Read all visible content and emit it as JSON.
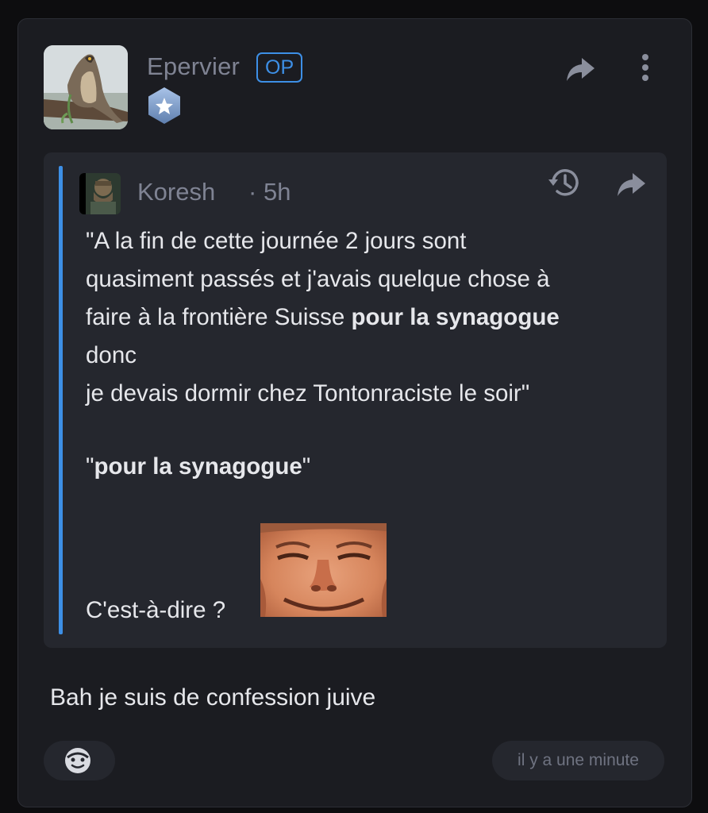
{
  "post": {
    "author": "Epervier",
    "op_badge": "OP",
    "reply_text": "Bah je suis de confession juive",
    "timestamp": "il y a une minute"
  },
  "quote": {
    "author": "Koresh",
    "separator": "·",
    "time": "5h",
    "line1": "\"A la fin de cette journée 2 jours sont",
    "line2": "quasiment passés et j'avais quelque chose à",
    "line3_pre": "faire à la frontière Suisse ",
    "line3_bold": "pour la synagogue",
    "line4": "donc",
    "line5": "je devais dormir chez Tontonraciste le soir\"",
    "emph_open": "\"",
    "emph_bold": "pour la synagogue",
    "emph_close": "\"",
    "last_line": "C'est-à-dire ?"
  },
  "icons": {
    "share_top": "share-arrow-icon",
    "more": "vertical-dots-icon",
    "rank": "hexagon-star-icon",
    "history": "history-clock-icon",
    "share_quote": "share-arrow-icon",
    "reaction": "emoji-face-icon"
  },
  "colors": {
    "accent": "#3d8fe6",
    "card_bg": "#1b1c21",
    "quote_bg": "#25272e",
    "muted_text": "#7f8393",
    "body_text": "#e6e7eb"
  }
}
